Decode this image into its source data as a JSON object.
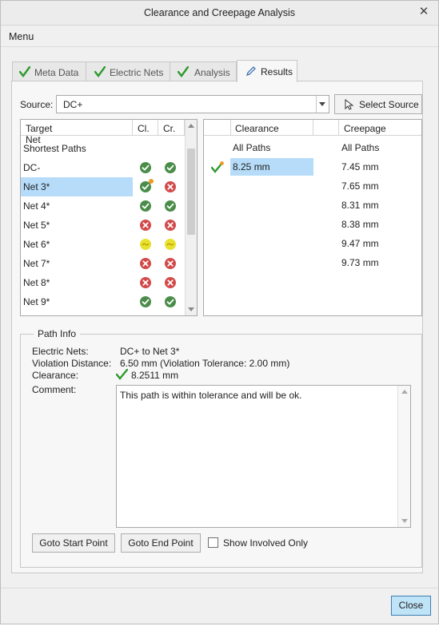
{
  "window": {
    "title": "Clearance and Creepage Analysis",
    "close_glyph": "✕"
  },
  "menu": {
    "label": "Menu"
  },
  "tabs": [
    {
      "label": "Meta Data",
      "icon": "check-icon",
      "active": false
    },
    {
      "label": "Electric Nets",
      "icon": "check-icon",
      "active": false
    },
    {
      "label": "Analysis",
      "icon": "check-icon",
      "active": false
    },
    {
      "label": "Results",
      "icon": "pencil-icon",
      "active": true
    }
  ],
  "source": {
    "label": "Source:",
    "value": "DC+",
    "button_label": "Select Source"
  },
  "target_table": {
    "headers": {
      "name": "Target Net",
      "cl": "Cl.",
      "cr": "Cr."
    },
    "rows": [
      {
        "name": "Shortest Paths",
        "cl": "",
        "cr": ""
      },
      {
        "name": "DC-",
        "cl": "ok",
        "cr": "ok"
      },
      {
        "name": "Net 3*",
        "cl": "ok-marked",
        "cr": "bad",
        "selected": true
      },
      {
        "name": "Net 4*",
        "cl": "ok",
        "cr": "ok"
      },
      {
        "name": "Net 5*",
        "cl": "bad",
        "cr": "bad"
      },
      {
        "name": "Net 6*",
        "cl": "warn",
        "cr": "warn"
      },
      {
        "name": "Net 7*",
        "cl": "bad",
        "cr": "bad"
      },
      {
        "name": "Net 8*",
        "cl": "bad",
        "cr": "bad"
      },
      {
        "name": "Net 9*",
        "cl": "ok",
        "cr": "ok"
      }
    ]
  },
  "results_table": {
    "headers": {
      "clearance": "Clearance",
      "creepage": "Creepage"
    },
    "rows": [
      {
        "clearance": "All Paths",
        "creepage": "All Paths"
      },
      {
        "clearance": "8.25 mm",
        "creepage": "7.45 mm",
        "selected": true,
        "marker": "check-marked"
      },
      {
        "clearance": "",
        "creepage": "7.65 mm"
      },
      {
        "clearance": "",
        "creepage": "8.31 mm"
      },
      {
        "clearance": "",
        "creepage": "8.38 mm"
      },
      {
        "clearance": "",
        "creepage": "9.47 mm"
      },
      {
        "clearance": "",
        "creepage": "9.73 mm"
      }
    ]
  },
  "path_info": {
    "title": "Path Info",
    "electric_nets_label": "Electric Nets:",
    "electric_nets_value": "DC+ to Net 3*",
    "violation_label": "Violation Distance:",
    "violation_value": "6.50 mm (Violation Tolerance: 2.00 mm)",
    "clearance_label": "Clearance:",
    "clearance_value": "8.2511 mm",
    "comment_label": "Comment:",
    "comment_text": "This path is within tolerance and will be ok."
  },
  "buttons": {
    "goto_start": "Goto Start Point",
    "goto_end": "Goto End Point",
    "show_involved": "Show Involved Only",
    "close": "Close"
  },
  "colors": {
    "ok": "#4a8c49",
    "bad": "#d24a4a",
    "warn": "#e6e22f",
    "check": "#2e9a2e",
    "selection": "#b6dcf9",
    "marker": "#f09a21"
  }
}
